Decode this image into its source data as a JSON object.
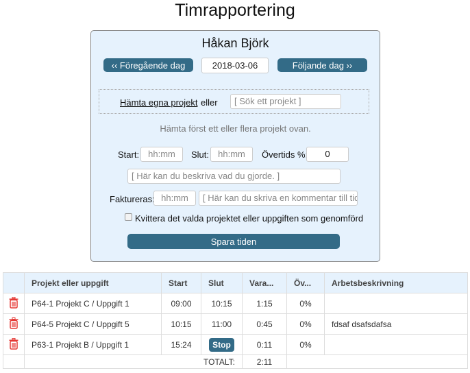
{
  "page": {
    "title": "Timrapportering"
  },
  "form": {
    "user_name": "Håkan Björk",
    "prev_day_label": "‹‹ Föregående dag",
    "next_day_label": "Följande dag ››",
    "date_value": "2018-03-06",
    "fetch_own_projects_label": "Hämta egna projekt",
    "or_label": "eller",
    "search_placeholder": "[ Sök ett projekt ]",
    "hint": "Hämta först ett eller flera projekt ovan.",
    "start_label": "Start:",
    "start_placeholder": "hh:mm",
    "end_label": "Slut:",
    "end_placeholder": "hh:mm",
    "overtime_label": "Övertids %:",
    "overtime_value": "0",
    "description_placeholder": "[ Här kan du beskriva vad du gjorde. ]",
    "invoice_label": "Faktureras:",
    "invoice_placeholder": "hh:mm",
    "comment_placeholder": "[ Här kan du skriva en kommentar till tiden ]",
    "complete_checkbox_label": "Kvittera det valda projektet eller uppgiften som genomförd",
    "complete_checked": false,
    "save_label": "Spara tiden"
  },
  "table": {
    "headers": [
      "",
      "Projekt eller uppgift",
      "Start",
      "Slut",
      "Vara...",
      "Öv...",
      "Arbetsbeskrivning"
    ],
    "rows": [
      {
        "project": "P64-1 Projekt C / Uppgift 1",
        "start": "09:00",
        "end": "10:15",
        "duration": "1:15",
        "overtime": "0%",
        "description": ""
      },
      {
        "project": "P64-5 Projekt C / Uppgift 5",
        "start": "10:15",
        "end": "11:00",
        "duration": "0:45",
        "overtime": "0%",
        "description": "fdsaf dsafsdafsa"
      },
      {
        "project": "P63-1 Projekt B / Uppgift 1",
        "start": "15:24",
        "end": "",
        "stop_label": "Stop",
        "duration": "0:11",
        "overtime": "0%",
        "description": ""
      }
    ],
    "total_label": "TOTALT:",
    "total_value": "2:11"
  },
  "colors": {
    "accent": "#336b87",
    "panel_bg": "#e6f2fd",
    "trash": "#e53935"
  }
}
